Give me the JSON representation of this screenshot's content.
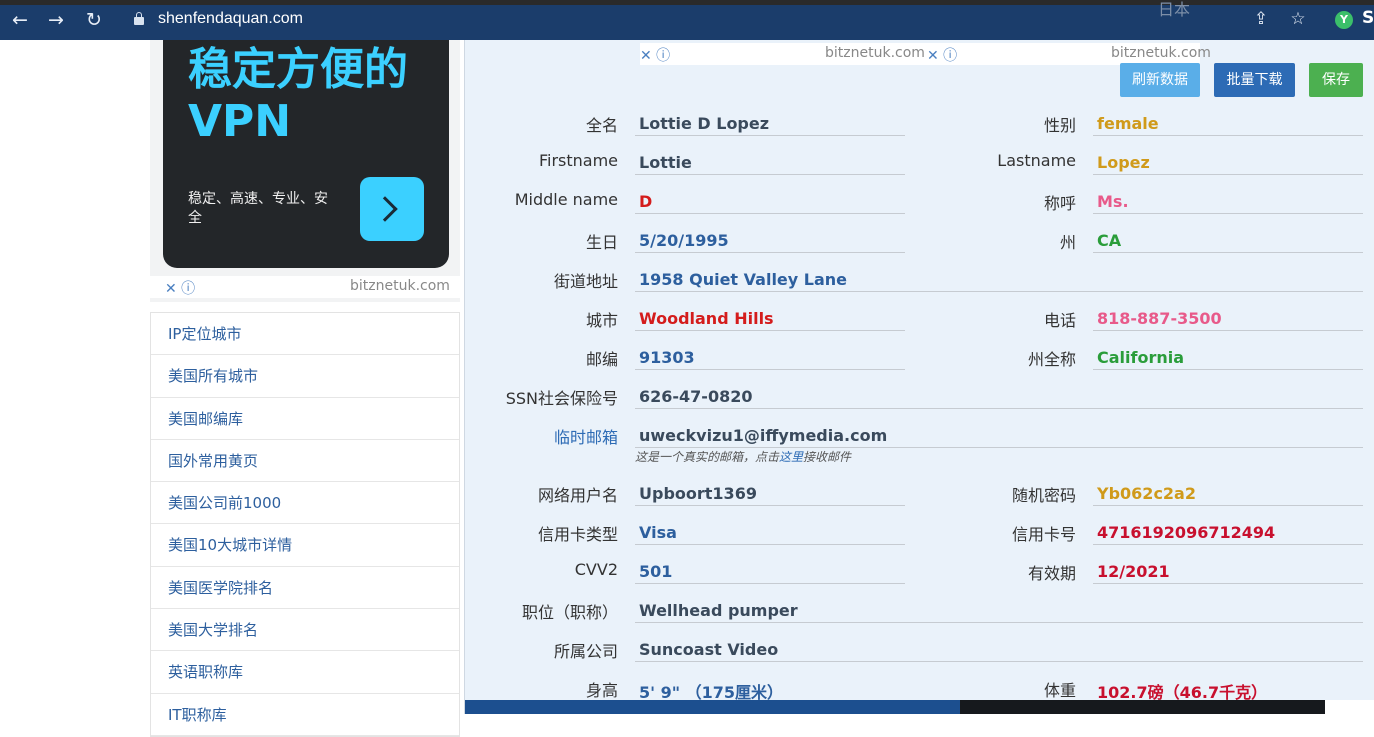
{
  "browser": {
    "url": "shenfendaquan.com",
    "ghost_text": "日本"
  },
  "ad": {
    "title_line1": "稳定方便的",
    "title_line2": "VPN",
    "subtitle": "稳定、高速、专业、安全",
    "close_mark": "✕ ⓘ",
    "source": "bitznetuk.com"
  },
  "menu": [
    "IP定位城市",
    "美国所有城市",
    "美国邮编库",
    "国外常用黄页",
    "美国公司前1000",
    "美国10大城市详情",
    "美国医学院排名",
    "美国大学排名",
    "英语职称库",
    "IT职称库"
  ],
  "top_ad": {
    "close_mark": "✕ ⓘ",
    "source": "bitznetuk.com"
  },
  "buttons": {
    "refresh": "刷新数据",
    "batch_download": "批量下载",
    "save": "保存"
  },
  "colors": {
    "refresh": "#5aaee8",
    "batch_download": "#2d6bb5",
    "save": "#4cb050"
  },
  "fields": {
    "fullname": {
      "label": "全名",
      "value": "Lottie D Lopez"
    },
    "gender": {
      "label": "性别",
      "value": "female"
    },
    "firstname": {
      "label": "Firstname",
      "value": "Lottie"
    },
    "lastname": {
      "label": "Lastname",
      "value": "Lopez"
    },
    "middlename": {
      "label": "Middle name",
      "value": "D"
    },
    "title": {
      "label": "称呼",
      "value": "Ms."
    },
    "birthday": {
      "label": "生日",
      "value": "5/20/1995"
    },
    "state": {
      "label": "州",
      "value": "CA"
    },
    "street": {
      "label": "街道地址",
      "value": "1958 Quiet Valley Lane"
    },
    "city": {
      "label": "城市",
      "value": "Woodland Hills"
    },
    "phone": {
      "label": "电话",
      "value": "818-887-3500"
    },
    "zip": {
      "label": "邮编",
      "value": "91303"
    },
    "state_full": {
      "label": "州全称",
      "value": "California"
    },
    "ssn": {
      "label": "SSN社会保险号",
      "value": "626-47-0820"
    },
    "temp_email": {
      "label": "临时邮箱",
      "value": "uweckvizu1@iffymedia.com"
    },
    "username": {
      "label": "网络用户名",
      "value": "Upboort1369"
    },
    "password": {
      "label": "随机密码",
      "value": "Yb062c2a2"
    },
    "card_type": {
      "label": "信用卡类型",
      "value": "Visa"
    },
    "card_number": {
      "label": "信用卡号",
      "value": "4716192096712494"
    },
    "cvv": {
      "label": "CVV2",
      "value": "501"
    },
    "expiry": {
      "label": "有效期",
      "value": "12/2021"
    },
    "occupation": {
      "label": "职位（职称）",
      "value": "Wellhead pumper"
    },
    "company": {
      "label": "所属公司",
      "value": "Suncoast Video"
    },
    "height": {
      "label": "身高",
      "value": "5' 9\" （175厘米）"
    },
    "weight": {
      "label": "体重",
      "value": "102.7磅（46.7千克）"
    }
  },
  "email_note": {
    "before": "这是一个真实的邮箱，点击",
    "link": "这里",
    "after": "接收邮件"
  }
}
